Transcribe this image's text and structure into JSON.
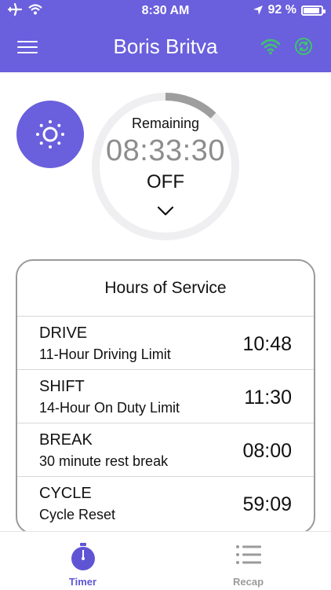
{
  "status_bar": {
    "time": "8:30 AM",
    "battery_text": "92 %"
  },
  "header": {
    "title": "Boris Britva",
    "icons": [
      "menu-icon",
      "wifi-icon",
      "sync-icon"
    ]
  },
  "timer": {
    "remaining_label": "Remaining",
    "remaining_value": "08:33:30",
    "status": "OFF",
    "progress_fraction": 0.12
  },
  "hos": {
    "title": "Hours of Service",
    "rows": [
      {
        "name": "DRIVE",
        "desc": "11-Hour Driving Limit",
        "time": "10:48"
      },
      {
        "name": "SHIFT",
        "desc": "14-Hour On Duty Limit",
        "time": "11:30"
      },
      {
        "name": "BREAK",
        "desc": "30 minute rest break",
        "time": "08:00"
      },
      {
        "name": "CYCLE",
        "desc": "Cycle Reset",
        "time": "59:09"
      }
    ]
  },
  "tabs": [
    {
      "label": "Timer",
      "active": true
    },
    {
      "label": "Recap",
      "active": false
    }
  ],
  "colors": {
    "brand": "#6a5fdc",
    "accent_green": "#3ec46d",
    "ring_track": "#efeff1",
    "ring_progress": "#9e9e9e"
  }
}
